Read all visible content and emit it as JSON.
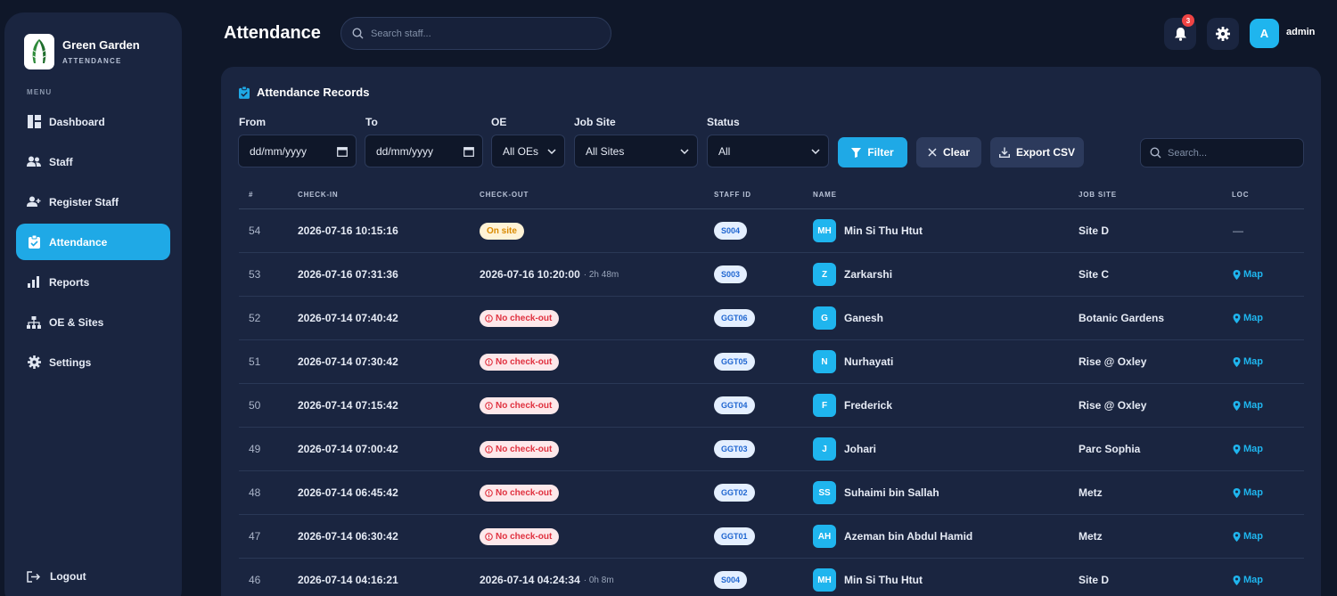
{
  "sidebar": {
    "brand_name": "Green Garden",
    "brand_sub": "ATTENDANCE",
    "menu_label": "MENU",
    "items": [
      {
        "label": "Dashboard",
        "icon": "dashboard-icon"
      },
      {
        "label": "Staff",
        "icon": "users-icon"
      },
      {
        "label": "Register Staff",
        "icon": "user-plus-icon"
      },
      {
        "label": "Attendance",
        "icon": "clipboard-icon",
        "active": true
      },
      {
        "label": "Reports",
        "icon": "bar-chart-icon"
      },
      {
        "label": "OE & Sites",
        "icon": "sitemap-icon"
      },
      {
        "label": "Settings",
        "icon": "gear-icon"
      }
    ],
    "logout_label": "Logout"
  },
  "header": {
    "title": "Attendance",
    "search_placeholder": "Search staff...",
    "notification_count": "3",
    "user_initial": "A",
    "user_name": "admin"
  },
  "card": {
    "title": "Attendance Records",
    "filters": {
      "from_label": "From",
      "from_value": "dd/mm/yyyy",
      "to_label": "To",
      "to_value": "dd/mm/yyyy",
      "oe_label": "OE",
      "oe_value": "All OEs",
      "site_label": "Job Site",
      "site_value": "All Sites",
      "status_label": "Status",
      "status_value": "All"
    },
    "buttons": {
      "filter": "Filter",
      "clear": "Clear",
      "export": "Export CSV"
    },
    "search_placeholder": "Search..."
  },
  "table": {
    "columns": [
      "#",
      "CHECK-IN",
      "CHECK-OUT",
      "STAFF ID",
      "NAME",
      "JOB SITE",
      "LOC"
    ],
    "map_label": "Map",
    "rows": [
      {
        "num": "54",
        "checkin": "2026-07-16 10:15:16",
        "checkout_type": "onsite",
        "checkout": "On site",
        "duration": "",
        "staff_id": "S004",
        "initials": "MH",
        "name": "Min Si Thu Htut",
        "site": "Site D",
        "loc": "—"
      },
      {
        "num": "53",
        "checkin": "2026-07-16 07:31:36",
        "checkout_type": "done",
        "checkout": "2026-07-16 10:20:00",
        "duration": "· 2h 48m",
        "staff_id": "S003",
        "initials": "Z",
        "name": "Zarkarshi",
        "site": "Site C",
        "loc": "Map"
      },
      {
        "num": "52",
        "checkin": "2026-07-14 07:40:42",
        "checkout_type": "none",
        "checkout": "No check-out",
        "duration": "",
        "staff_id": "GGT06",
        "initials": "G",
        "name": "Ganesh",
        "site": "Botanic Gardens",
        "loc": "Map"
      },
      {
        "num": "51",
        "checkin": "2026-07-14 07:30:42",
        "checkout_type": "none",
        "checkout": "No check-out",
        "duration": "",
        "staff_id": "GGT05",
        "initials": "N",
        "name": "Nurhayati",
        "site": "Rise @ Oxley",
        "loc": "Map"
      },
      {
        "num": "50",
        "checkin": "2026-07-14 07:15:42",
        "checkout_type": "none",
        "checkout": "No check-out",
        "duration": "",
        "staff_id": "GGT04",
        "initials": "F",
        "name": "Frederick",
        "site": "Rise @ Oxley",
        "loc": "Map"
      },
      {
        "num": "49",
        "checkin": "2026-07-14 07:00:42",
        "checkout_type": "none",
        "checkout": "No check-out",
        "duration": "",
        "staff_id": "GGT03",
        "initials": "J",
        "name": "Johari",
        "site": "Parc Sophia",
        "loc": "Map"
      },
      {
        "num": "48",
        "checkin": "2026-07-14 06:45:42",
        "checkout_type": "none",
        "checkout": "No check-out",
        "duration": "",
        "staff_id": "GGT02",
        "initials": "SS",
        "name": "Suhaimi bin Sallah",
        "site": "Metz",
        "loc": "Map"
      },
      {
        "num": "47",
        "checkin": "2026-07-14 06:30:42",
        "checkout_type": "none",
        "checkout": "No check-out",
        "duration": "",
        "staff_id": "GGT01",
        "initials": "AH",
        "name": "Azeman bin Abdul Hamid",
        "site": "Metz",
        "loc": "Map"
      },
      {
        "num": "46",
        "checkin": "2026-07-14 04:16:21",
        "checkout_type": "done",
        "checkout": "2026-07-14 04:24:34",
        "duration": "· 0h 8m",
        "staff_id": "S004",
        "initials": "MH",
        "name": "Min Si Thu Htut",
        "site": "Site D",
        "loc": "Map"
      }
    ]
  },
  "colors": {
    "accent": "#1fa9e6",
    "background": "#0f1729",
    "panel": "#1a2540",
    "danger": "#e0313f",
    "warning": "#d98a00"
  }
}
